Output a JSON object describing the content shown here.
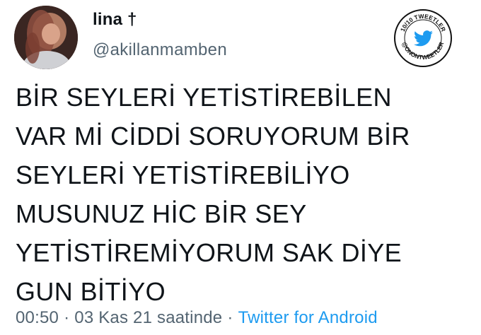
{
  "user": {
    "display_name": "lina †",
    "handle": "@akillanmamben"
  },
  "badge": {
    "text_top": "10/10 TWEETLER",
    "text_bottom": "@ONONTWEETLER",
    "icon": "twitter-bird-icon"
  },
  "tweet": {
    "lines": [
      "BİR SEYLERİ YETİSTİREBİLEN",
      "VAR Mİ CİDDİ SORUYORUM BİR",
      "SEYLERİ YETİSTİREBİLİYO",
      "MUSUNUZ HİC BİR SEY",
      "YETİSTİREMİYORUM SAK DİYE",
      "GUN BİTİYO"
    ]
  },
  "meta": {
    "time": "00:50",
    "separator": "·",
    "date": "03 Kas 21 saatinde",
    "source": "Twitter for Android"
  },
  "colors": {
    "text": "#0f1419",
    "secondary": "#536471",
    "accent": "#1d9bf0"
  }
}
